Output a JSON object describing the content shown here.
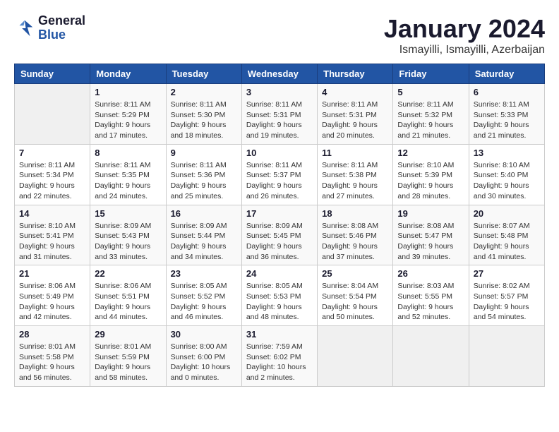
{
  "header": {
    "logo_line1": "General",
    "logo_line2": "Blue",
    "title": "January 2024",
    "subtitle": "Ismayilli, Ismayilli, Azerbaijan"
  },
  "weekdays": [
    "Sunday",
    "Monday",
    "Tuesday",
    "Wednesday",
    "Thursday",
    "Friday",
    "Saturday"
  ],
  "weeks": [
    [
      {
        "num": "",
        "empty": true
      },
      {
        "num": "1",
        "rise": "8:11 AM",
        "set": "5:29 PM",
        "daylight": "9 hours and 17 minutes."
      },
      {
        "num": "2",
        "rise": "8:11 AM",
        "set": "5:30 PM",
        "daylight": "9 hours and 18 minutes."
      },
      {
        "num": "3",
        "rise": "8:11 AM",
        "set": "5:31 PM",
        "daylight": "9 hours and 19 minutes."
      },
      {
        "num": "4",
        "rise": "8:11 AM",
        "set": "5:31 PM",
        "daylight": "9 hours and 20 minutes."
      },
      {
        "num": "5",
        "rise": "8:11 AM",
        "set": "5:32 PM",
        "daylight": "9 hours and 21 minutes."
      },
      {
        "num": "6",
        "rise": "8:11 AM",
        "set": "5:33 PM",
        "daylight": "9 hours and 21 minutes."
      }
    ],
    [
      {
        "num": "7",
        "rise": "8:11 AM",
        "set": "5:34 PM",
        "daylight": "9 hours and 22 minutes."
      },
      {
        "num": "8",
        "rise": "8:11 AM",
        "set": "5:35 PM",
        "daylight": "9 hours and 24 minutes."
      },
      {
        "num": "9",
        "rise": "8:11 AM",
        "set": "5:36 PM",
        "daylight": "9 hours and 25 minutes."
      },
      {
        "num": "10",
        "rise": "8:11 AM",
        "set": "5:37 PM",
        "daylight": "9 hours and 26 minutes."
      },
      {
        "num": "11",
        "rise": "8:11 AM",
        "set": "5:38 PM",
        "daylight": "9 hours and 27 minutes."
      },
      {
        "num": "12",
        "rise": "8:10 AM",
        "set": "5:39 PM",
        "daylight": "9 hours and 28 minutes."
      },
      {
        "num": "13",
        "rise": "8:10 AM",
        "set": "5:40 PM",
        "daylight": "9 hours and 30 minutes."
      }
    ],
    [
      {
        "num": "14",
        "rise": "8:10 AM",
        "set": "5:41 PM",
        "daylight": "9 hours and 31 minutes."
      },
      {
        "num": "15",
        "rise": "8:09 AM",
        "set": "5:43 PM",
        "daylight": "9 hours and 33 minutes."
      },
      {
        "num": "16",
        "rise": "8:09 AM",
        "set": "5:44 PM",
        "daylight": "9 hours and 34 minutes."
      },
      {
        "num": "17",
        "rise": "8:09 AM",
        "set": "5:45 PM",
        "daylight": "9 hours and 36 minutes."
      },
      {
        "num": "18",
        "rise": "8:08 AM",
        "set": "5:46 PM",
        "daylight": "9 hours and 37 minutes."
      },
      {
        "num": "19",
        "rise": "8:08 AM",
        "set": "5:47 PM",
        "daylight": "9 hours and 39 minutes."
      },
      {
        "num": "20",
        "rise": "8:07 AM",
        "set": "5:48 PM",
        "daylight": "9 hours and 41 minutes."
      }
    ],
    [
      {
        "num": "21",
        "rise": "8:06 AM",
        "set": "5:49 PM",
        "daylight": "9 hours and 42 minutes."
      },
      {
        "num": "22",
        "rise": "8:06 AM",
        "set": "5:51 PM",
        "daylight": "9 hours and 44 minutes."
      },
      {
        "num": "23",
        "rise": "8:05 AM",
        "set": "5:52 PM",
        "daylight": "9 hours and 46 minutes."
      },
      {
        "num": "24",
        "rise": "8:05 AM",
        "set": "5:53 PM",
        "daylight": "9 hours and 48 minutes."
      },
      {
        "num": "25",
        "rise": "8:04 AM",
        "set": "5:54 PM",
        "daylight": "9 hours and 50 minutes."
      },
      {
        "num": "26",
        "rise": "8:03 AM",
        "set": "5:55 PM",
        "daylight": "9 hours and 52 minutes."
      },
      {
        "num": "27",
        "rise": "8:02 AM",
        "set": "5:57 PM",
        "daylight": "9 hours and 54 minutes."
      }
    ],
    [
      {
        "num": "28",
        "rise": "8:01 AM",
        "set": "5:58 PM",
        "daylight": "9 hours and 56 minutes."
      },
      {
        "num": "29",
        "rise": "8:01 AM",
        "set": "5:59 PM",
        "daylight": "9 hours and 58 minutes."
      },
      {
        "num": "30",
        "rise": "8:00 AM",
        "set": "6:00 PM",
        "daylight": "10 hours and 0 minutes."
      },
      {
        "num": "31",
        "rise": "7:59 AM",
        "set": "6:02 PM",
        "daylight": "10 hours and 2 minutes."
      },
      {
        "num": "",
        "empty": true
      },
      {
        "num": "",
        "empty": true
      },
      {
        "num": "",
        "empty": true
      }
    ]
  ]
}
